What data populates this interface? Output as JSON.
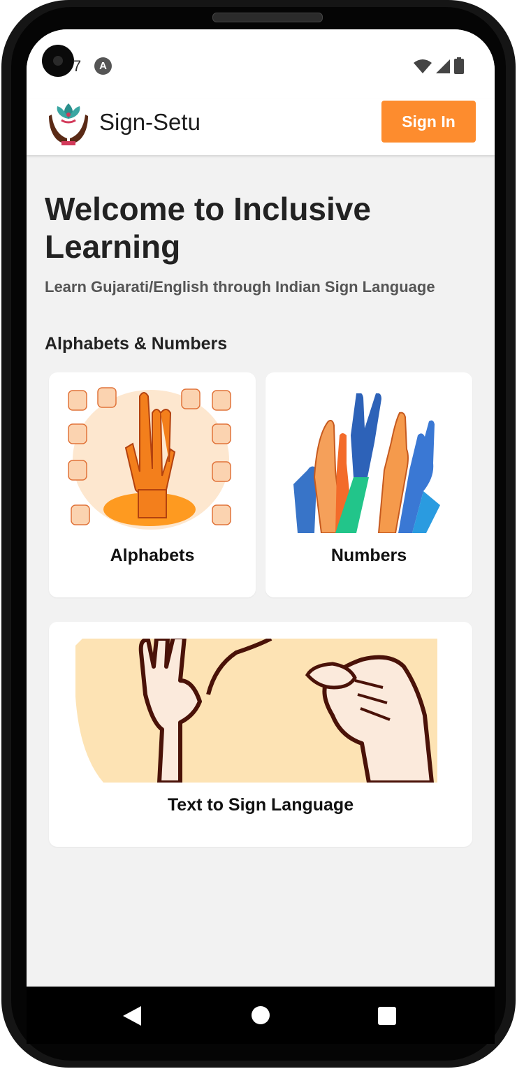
{
  "status_bar": {
    "time": "7",
    "app_icon": "A-icon"
  },
  "header": {
    "title": "Sign-Setu",
    "sign_in_label": "Sign In"
  },
  "hero": {
    "title": "Welcome to Inclusive Learning",
    "subtitle": "Learn Gujarati/English through Indian Sign Language"
  },
  "section": {
    "title": "Alphabets & Numbers"
  },
  "cards": {
    "alphabets": "Alphabets",
    "numbers": "Numbers",
    "text_to_sign": "Text to Sign Language"
  },
  "colors": {
    "accent": "#fd8c2e",
    "background": "#f2f2f2",
    "card": "#ffffff"
  }
}
